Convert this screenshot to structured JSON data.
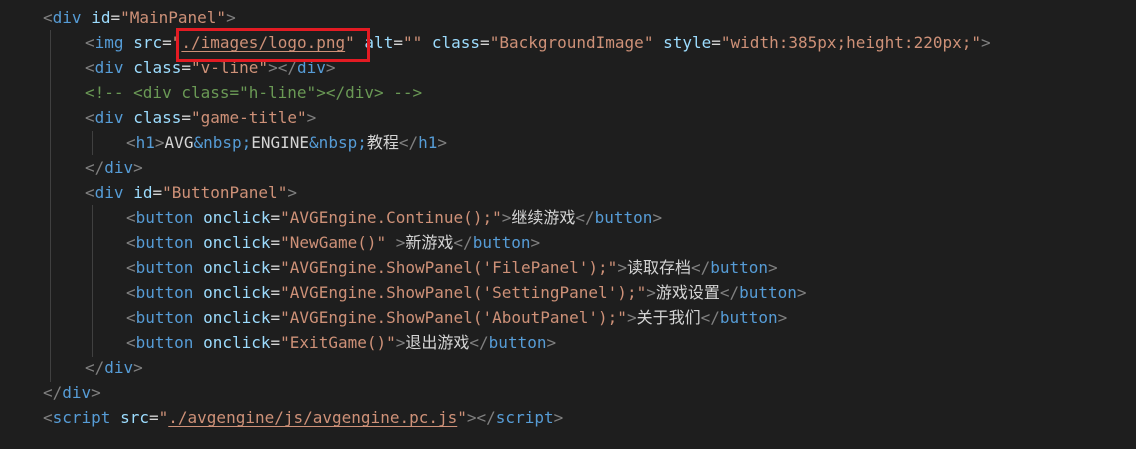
{
  "editor": {
    "highlight_color": "#e31b23",
    "lines": [
      [
        {
          "t": "<",
          "c": "punct"
        },
        {
          "t": "div",
          "c": "tag"
        },
        {
          "t": " ",
          "c": "text"
        },
        {
          "t": "id",
          "c": "attr"
        },
        {
          "t": "=",
          "c": "text"
        },
        {
          "t": "\"MainPanel\"",
          "c": "str"
        },
        {
          "t": ">",
          "c": "punct"
        }
      ],
      [
        {
          "t": "<",
          "c": "punct"
        },
        {
          "t": "img",
          "c": "tag"
        },
        {
          "t": " ",
          "c": "text"
        },
        {
          "t": "src",
          "c": "attr"
        },
        {
          "t": "=",
          "c": "text"
        },
        {
          "t": "\"",
          "c": "str"
        },
        {
          "t": "./images/logo.png",
          "c": "str",
          "u": true
        },
        {
          "t": "\"",
          "c": "str"
        },
        {
          "t": " ",
          "c": "text"
        },
        {
          "t": "alt",
          "c": "attr"
        },
        {
          "t": "=",
          "c": "text"
        },
        {
          "t": "\"\"",
          "c": "str"
        },
        {
          "t": " ",
          "c": "text"
        },
        {
          "t": "class",
          "c": "attr"
        },
        {
          "t": "=",
          "c": "text"
        },
        {
          "t": "\"BackgroundImage\"",
          "c": "str"
        },
        {
          "t": " ",
          "c": "text"
        },
        {
          "t": "style",
          "c": "attr"
        },
        {
          "t": "=",
          "c": "text"
        },
        {
          "t": "\"width:385px;height:220px;\"",
          "c": "str"
        },
        {
          "t": ">",
          "c": "punct"
        }
      ],
      [
        {
          "t": "<",
          "c": "punct"
        },
        {
          "t": "div",
          "c": "tag"
        },
        {
          "t": " ",
          "c": "text"
        },
        {
          "t": "class",
          "c": "attr"
        },
        {
          "t": "=",
          "c": "text"
        },
        {
          "t": "\"v-line\"",
          "c": "str"
        },
        {
          "t": ">",
          "c": "punct"
        },
        {
          "t": "</",
          "c": "punct"
        },
        {
          "t": "div",
          "c": "tag"
        },
        {
          "t": ">",
          "c": "punct"
        }
      ],
      [
        {
          "t": "<!-- <div class=\"h-line\"></div> -->",
          "c": "comment"
        }
      ],
      [
        {
          "t": "<",
          "c": "punct"
        },
        {
          "t": "div",
          "c": "tag"
        },
        {
          "t": " ",
          "c": "text"
        },
        {
          "t": "class",
          "c": "attr"
        },
        {
          "t": "=",
          "c": "text"
        },
        {
          "t": "\"game-title\"",
          "c": "str"
        },
        {
          "t": ">",
          "c": "punct"
        }
      ],
      [
        {
          "t": "<",
          "c": "punct"
        },
        {
          "t": "h1",
          "c": "tag"
        },
        {
          "t": ">",
          "c": "punct"
        },
        {
          "t": "AVG",
          "c": "text"
        },
        {
          "t": "&nbsp;",
          "c": "entity"
        },
        {
          "t": "ENGINE",
          "c": "text"
        },
        {
          "t": "&nbsp;",
          "c": "entity"
        },
        {
          "t": "教程",
          "c": "text"
        },
        {
          "t": "</",
          "c": "punct"
        },
        {
          "t": "h1",
          "c": "tag"
        },
        {
          "t": ">",
          "c": "punct"
        }
      ],
      [
        {
          "t": "</",
          "c": "punct"
        },
        {
          "t": "div",
          "c": "tag"
        },
        {
          "t": ">",
          "c": "punct"
        }
      ],
      [
        {
          "t": "<",
          "c": "punct"
        },
        {
          "t": "div",
          "c": "tag"
        },
        {
          "t": " ",
          "c": "text"
        },
        {
          "t": "id",
          "c": "attr"
        },
        {
          "t": "=",
          "c": "text"
        },
        {
          "t": "\"ButtonPanel\"",
          "c": "str"
        },
        {
          "t": ">",
          "c": "punct"
        }
      ],
      [
        {
          "t": "<",
          "c": "punct"
        },
        {
          "t": "button",
          "c": "tag"
        },
        {
          "t": " ",
          "c": "text"
        },
        {
          "t": "onclick",
          "c": "attr"
        },
        {
          "t": "=",
          "c": "text"
        },
        {
          "t": "\"AVGEngine.Continue();\"",
          "c": "str"
        },
        {
          "t": ">",
          "c": "punct"
        },
        {
          "t": "继续游戏",
          "c": "text"
        },
        {
          "t": "</",
          "c": "punct"
        },
        {
          "t": "button",
          "c": "tag"
        },
        {
          "t": ">",
          "c": "punct"
        }
      ],
      [
        {
          "t": "<",
          "c": "punct"
        },
        {
          "t": "button",
          "c": "tag"
        },
        {
          "t": " ",
          "c": "text"
        },
        {
          "t": "onclick",
          "c": "attr"
        },
        {
          "t": "=",
          "c": "text"
        },
        {
          "t": "\"NewGame()\"",
          "c": "str"
        },
        {
          "t": " ",
          "c": "text"
        },
        {
          "t": ">",
          "c": "punct"
        },
        {
          "t": "新游戏",
          "c": "text"
        },
        {
          "t": "</",
          "c": "punct"
        },
        {
          "t": "button",
          "c": "tag"
        },
        {
          "t": ">",
          "c": "punct"
        }
      ],
      [
        {
          "t": "<",
          "c": "punct"
        },
        {
          "t": "button",
          "c": "tag"
        },
        {
          "t": " ",
          "c": "text"
        },
        {
          "t": "onclick",
          "c": "attr"
        },
        {
          "t": "=",
          "c": "text"
        },
        {
          "t": "\"AVGEngine.ShowPanel('FilePanel');\"",
          "c": "str"
        },
        {
          "t": ">",
          "c": "punct"
        },
        {
          "t": "读取存档",
          "c": "text"
        },
        {
          "t": "</",
          "c": "punct"
        },
        {
          "t": "button",
          "c": "tag"
        },
        {
          "t": ">",
          "c": "punct"
        }
      ],
      [
        {
          "t": "<",
          "c": "punct"
        },
        {
          "t": "button",
          "c": "tag"
        },
        {
          "t": " ",
          "c": "text"
        },
        {
          "t": "onclick",
          "c": "attr"
        },
        {
          "t": "=",
          "c": "text"
        },
        {
          "t": "\"AVGEngine.ShowPanel('SettingPanel');\"",
          "c": "str"
        },
        {
          "t": ">",
          "c": "punct"
        },
        {
          "t": "游戏设置",
          "c": "text"
        },
        {
          "t": "</",
          "c": "punct"
        },
        {
          "t": "button",
          "c": "tag"
        },
        {
          "t": ">",
          "c": "punct"
        }
      ],
      [
        {
          "t": "<",
          "c": "punct"
        },
        {
          "t": "button",
          "c": "tag"
        },
        {
          "t": " ",
          "c": "text"
        },
        {
          "t": "onclick",
          "c": "attr"
        },
        {
          "t": "=",
          "c": "text"
        },
        {
          "t": "\"AVGEngine.ShowPanel('AboutPanel');\"",
          "c": "str"
        },
        {
          "t": ">",
          "c": "punct"
        },
        {
          "t": "关于我们",
          "c": "text"
        },
        {
          "t": "</",
          "c": "punct"
        },
        {
          "t": "button",
          "c": "tag"
        },
        {
          "t": ">",
          "c": "punct"
        }
      ],
      [
        {
          "t": "<",
          "c": "punct"
        },
        {
          "t": "button",
          "c": "tag"
        },
        {
          "t": " ",
          "c": "text"
        },
        {
          "t": "onclick",
          "c": "attr"
        },
        {
          "t": "=",
          "c": "text"
        },
        {
          "t": "\"ExitGame()\"",
          "c": "str"
        },
        {
          "t": ">",
          "c": "punct"
        },
        {
          "t": "退出游戏",
          "c": "text"
        },
        {
          "t": "</",
          "c": "punct"
        },
        {
          "t": "button",
          "c": "tag"
        },
        {
          "t": ">",
          "c": "punct"
        }
      ],
      [
        {
          "t": "</",
          "c": "punct"
        },
        {
          "t": "div",
          "c": "tag"
        },
        {
          "t": ">",
          "c": "punct"
        }
      ],
      [
        {
          "t": "</",
          "c": "punct"
        },
        {
          "t": "div",
          "c": "tag"
        },
        {
          "t": ">",
          "c": "punct"
        }
      ],
      [
        {
          "t": "<",
          "c": "punct"
        },
        {
          "t": "script",
          "c": "tag"
        },
        {
          "t": " ",
          "c": "text"
        },
        {
          "t": "src",
          "c": "attr"
        },
        {
          "t": "=",
          "c": "text"
        },
        {
          "t": "\"",
          "c": "str"
        },
        {
          "t": "./avgengine/js/avgengine.pc.js",
          "c": "str",
          "u": true
        },
        {
          "t": "\"",
          "c": "str"
        },
        {
          "t": ">",
          "c": "punct"
        },
        {
          "t": "</",
          "c": "punct"
        },
        {
          "t": "script",
          "c": "tag"
        },
        {
          "t": ">",
          "c": "punct"
        }
      ]
    ]
  }
}
